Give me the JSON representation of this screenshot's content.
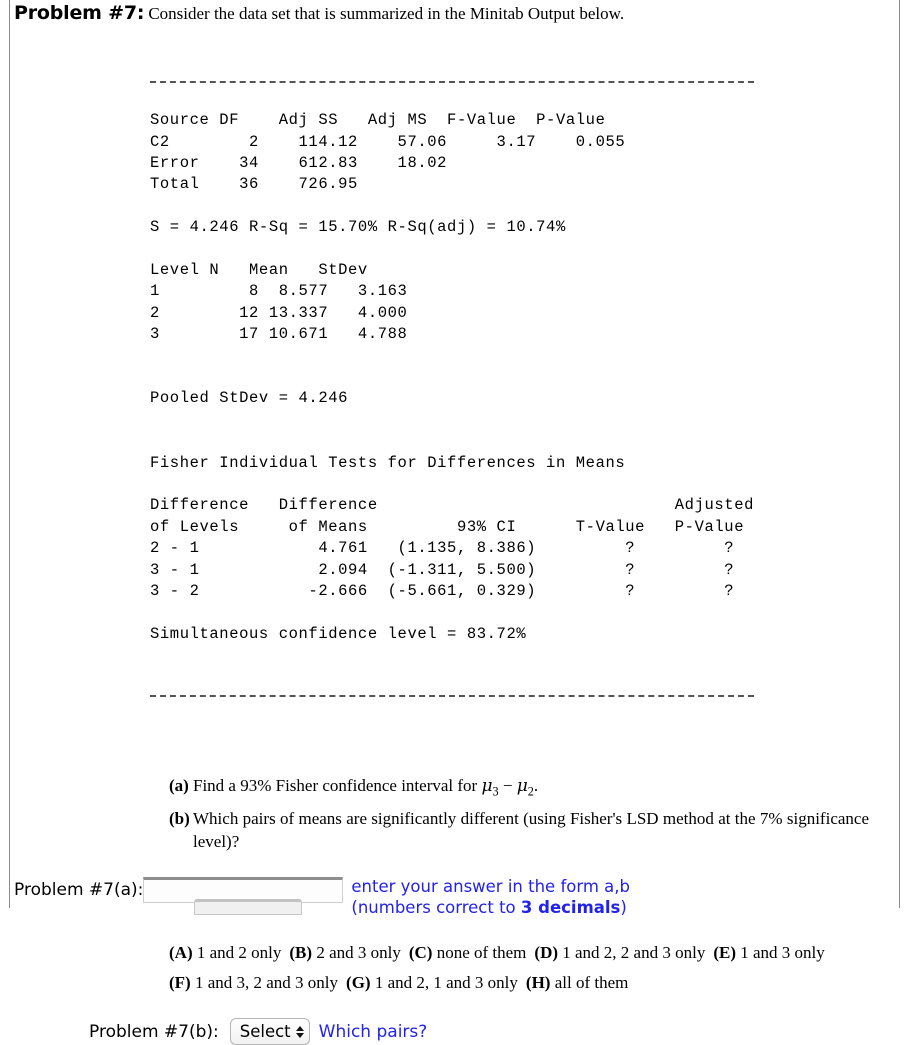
{
  "header": {
    "problem_label": "Problem #7:",
    "prompt": "Consider the data set that is summarized in the Minitab Output below."
  },
  "minitab": {
    "anova_header": "Source DF    Adj SS   Adj MS  F-Value  P-Value",
    "anova_rows": [
      "C2        2    114.12    57.06     3.17    0.055",
      "Error    34    612.83    18.02",
      "Total    36    726.95"
    ],
    "model_summary": "S = 4.246 R-Sq = 15.70% R-Sq(adj) = 10.74%",
    "level_header": "Level N   Mean   StDev",
    "level_rows": [
      "1         8  8.577   3.163",
      "2        12 13.337   4.000",
      "3        17 10.671   4.788"
    ],
    "pooled_stdev": "Pooled StDev = 4.246",
    "fisher_title": "Fisher Individual Tests for Differences in Means",
    "fisher_header_1": "Difference   Difference                              Adjusted",
    "fisher_header_2": "of Levels     of Means         93% CI      T-Value   P-Value",
    "fisher_rows": [
      "2 - 1            4.761   (1.135, 8.386)         ?         ?",
      "3 - 1            2.094  (-1.311, 5.500)         ?         ?",
      "3 - 2           -2.666  (-5.661, 0.329)         ?         ?"
    ],
    "simultaneous": "Simultaneous confidence level = 83.72%"
  },
  "questions": {
    "a_letter": "(a)",
    "a_text_before": "Find a 93% Fisher confidence interval for ",
    "a_mu_1": "μ",
    "a_sub_1": "3",
    "a_minus": " − ",
    "a_mu_2": "μ",
    "a_sub_2": "2",
    "a_text_after": ".",
    "b_letter": "(b)",
    "b_text": "Which pairs of means are significantly different (using Fisher's LSD method at the 7% significance level)?"
  },
  "answer_a": {
    "label": "Problem #7(a):",
    "input_value": "",
    "input_placeholder": "",
    "hint_line_1": "enter your answer in the form a,b",
    "hint_line_2_pre": "(numbers correct to ",
    "hint_line_2_bold": "3 decimals",
    "hint_line_2_post": ")",
    "hint_color": "#2222ee"
  },
  "choices": [
    {
      "letter": "(A)",
      "text": "1 and 2 only"
    },
    {
      "letter": "(B)",
      "text": "2 and 3 only"
    },
    {
      "letter": "(C)",
      "text": "none of them"
    },
    {
      "letter": "(D)",
      "text": "1 and 2, 2 and 3 only"
    },
    {
      "letter": "(E)",
      "text": "1 and 3 only"
    },
    {
      "letter": "(F)",
      "text": "1 and 3, 2 and 3 only"
    },
    {
      "letter": "(G)",
      "text": "1 and 2, 1 and 3 only"
    },
    {
      "letter": "(H)",
      "text": "all of them"
    }
  ],
  "answer_b": {
    "label": "Problem #7(b):",
    "select_value": "Select",
    "prompt": "Which pairs?"
  }
}
